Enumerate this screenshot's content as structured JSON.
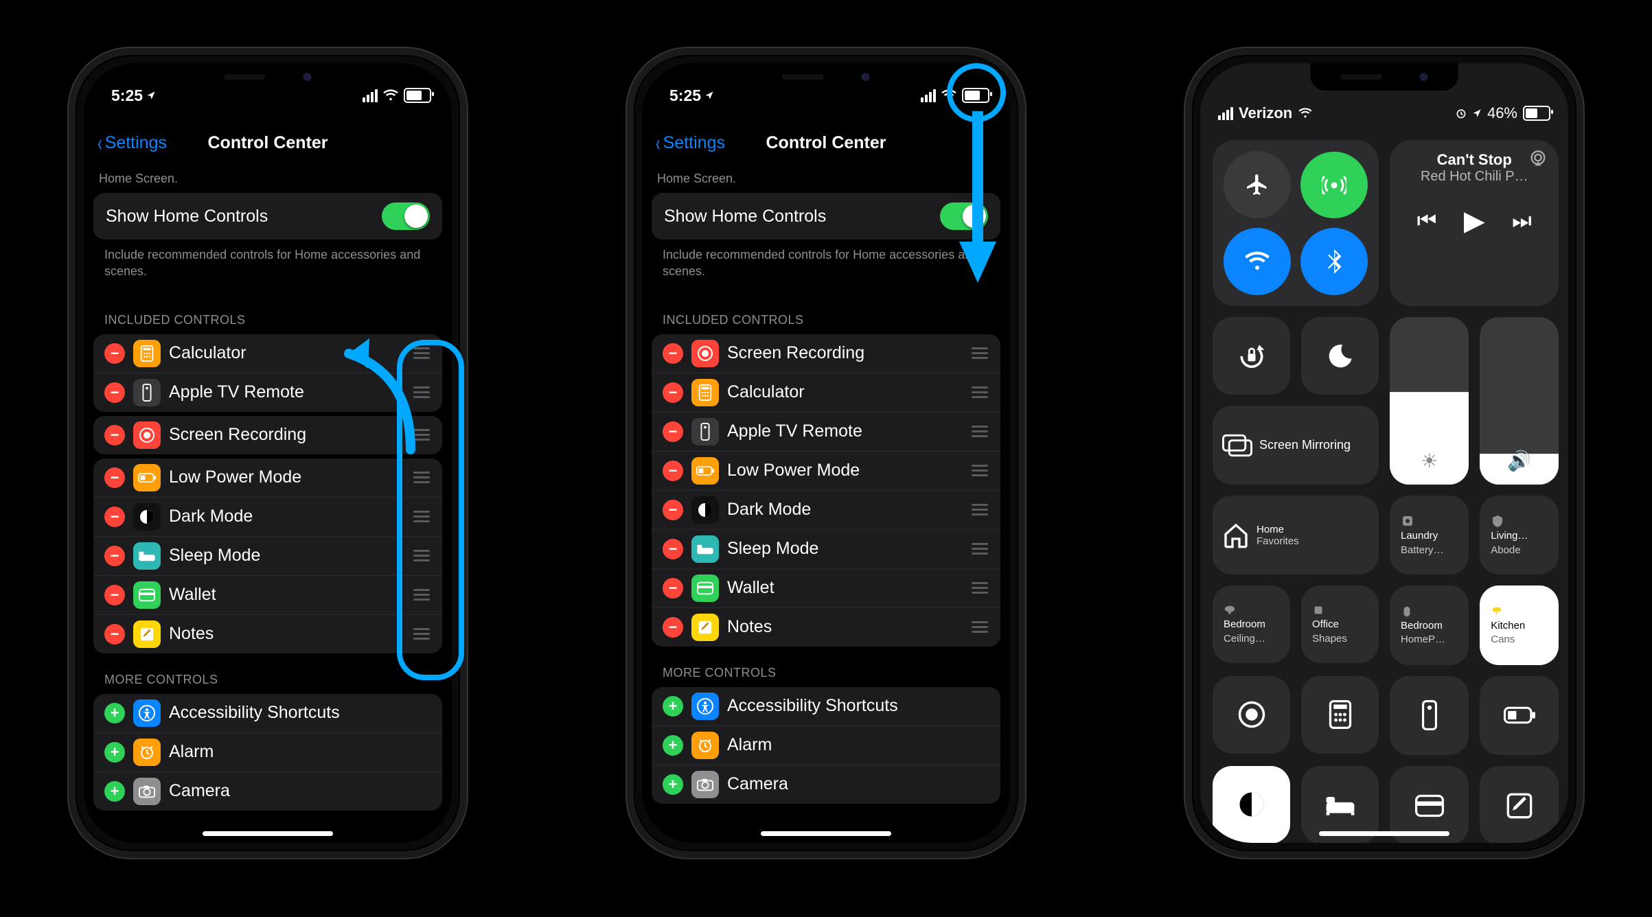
{
  "phone1": {
    "status": {
      "time": "5:25",
      "nav_arrow": true
    },
    "navbar": {
      "back": "Settings",
      "title": "Control Center"
    },
    "trunc": "Home Screen.",
    "show_home": {
      "label": "Show Home Controls",
      "on": true
    },
    "caption": "Include recommended controls for Home accessories and scenes.",
    "included_header": "INCLUDED CONTROLS",
    "included_top": [
      {
        "label": "Calculator",
        "icon_bg": "#ff9f0a",
        "icon": "calc"
      },
      {
        "label": "Apple TV Remote",
        "icon_bg": "#3a3a3c",
        "icon": "remote"
      }
    ],
    "included_float": {
      "label": "Screen Recording",
      "icon_bg": "#ff453a",
      "icon": "record"
    },
    "included_rest": [
      {
        "label": "Low Power Mode",
        "icon_bg": "#ff9f0a",
        "icon": "lowpower"
      },
      {
        "label": "Dark Mode",
        "icon_bg": "#111",
        "icon": "darkmode"
      },
      {
        "label": "Sleep Mode",
        "icon_bg": "#2eb8b3",
        "icon": "sleep"
      },
      {
        "label": "Wallet",
        "icon_bg": "#30d158",
        "icon": "wallet"
      },
      {
        "label": "Notes",
        "icon_bg": "#ffd60a",
        "icon": "notes"
      }
    ],
    "more_header": "MORE CONTROLS",
    "more": [
      {
        "label": "Accessibility Shortcuts",
        "icon_bg": "#0a84ff",
        "icon": "ax"
      },
      {
        "label": "Alarm",
        "icon_bg": "#ff9f0a",
        "icon": "alarm"
      },
      {
        "label": "Camera",
        "icon_bg": "#8e8e93",
        "icon": "camera"
      }
    ]
  },
  "phone2": {
    "status": {
      "time": "5:25"
    },
    "navbar": {
      "back": "Settings",
      "title": "Control Center"
    },
    "trunc": "Home Screen.",
    "show_home": {
      "label": "Show Home Controls",
      "on": true
    },
    "caption": "Include recommended controls for Home accessories and scenes.",
    "included_header": "INCLUDED CONTROLS",
    "included": [
      {
        "label": "Screen Recording",
        "icon_bg": "#ff453a",
        "icon": "record"
      },
      {
        "label": "Calculator",
        "icon_bg": "#ff9f0a",
        "icon": "calc"
      },
      {
        "label": "Apple TV Remote",
        "icon_bg": "#3a3a3c",
        "icon": "remote"
      },
      {
        "label": "Low Power Mode",
        "icon_bg": "#ff9f0a",
        "icon": "lowpower"
      },
      {
        "label": "Dark Mode",
        "icon_bg": "#111",
        "icon": "darkmode"
      },
      {
        "label": "Sleep Mode",
        "icon_bg": "#2eb8b3",
        "icon": "sleep"
      },
      {
        "label": "Wallet",
        "icon_bg": "#30d158",
        "icon": "wallet"
      },
      {
        "label": "Notes",
        "icon_bg": "#ffd60a",
        "icon": "notes"
      }
    ],
    "more_header": "MORE CONTROLS",
    "more": [
      {
        "label": "Accessibility Shortcuts",
        "icon_bg": "#0a84ff",
        "icon": "ax"
      },
      {
        "label": "Alarm",
        "icon_bg": "#ff9f0a",
        "icon": "alarm"
      },
      {
        "label": "Camera",
        "icon_bg": "#8e8e93",
        "icon": "camera"
      }
    ]
  },
  "phone3": {
    "status": {
      "carrier": "Verizon",
      "battery_pct": "46%"
    },
    "media": {
      "title": "Can't Stop",
      "subtitle": "Red Hot Chili P…"
    },
    "mirror_label": "Screen Mirroring",
    "home_tile": {
      "t1": "Home",
      "t2": "Favorites"
    },
    "tiles_row5": [
      {
        "t1": "Laundry",
        "t2": "Battery…"
      },
      {
        "t1": "Living…",
        "t2": "Abode"
      }
    ],
    "tiles_row6": [
      {
        "t1": "Bedroom",
        "t2": "Ceiling…"
      },
      {
        "t1": "Office",
        "t2": "Shapes"
      },
      {
        "t1": "Bedroom",
        "t2": "HomeP…"
      },
      {
        "t1": "Kitchen",
        "t2": "Cans",
        "white": true
      }
    ],
    "bottom_icons": [
      "record",
      "calc",
      "remote",
      "lowpower"
    ],
    "bottom_icons2": [
      "darkmode",
      "sleep",
      "wallet",
      "notes"
    ]
  }
}
